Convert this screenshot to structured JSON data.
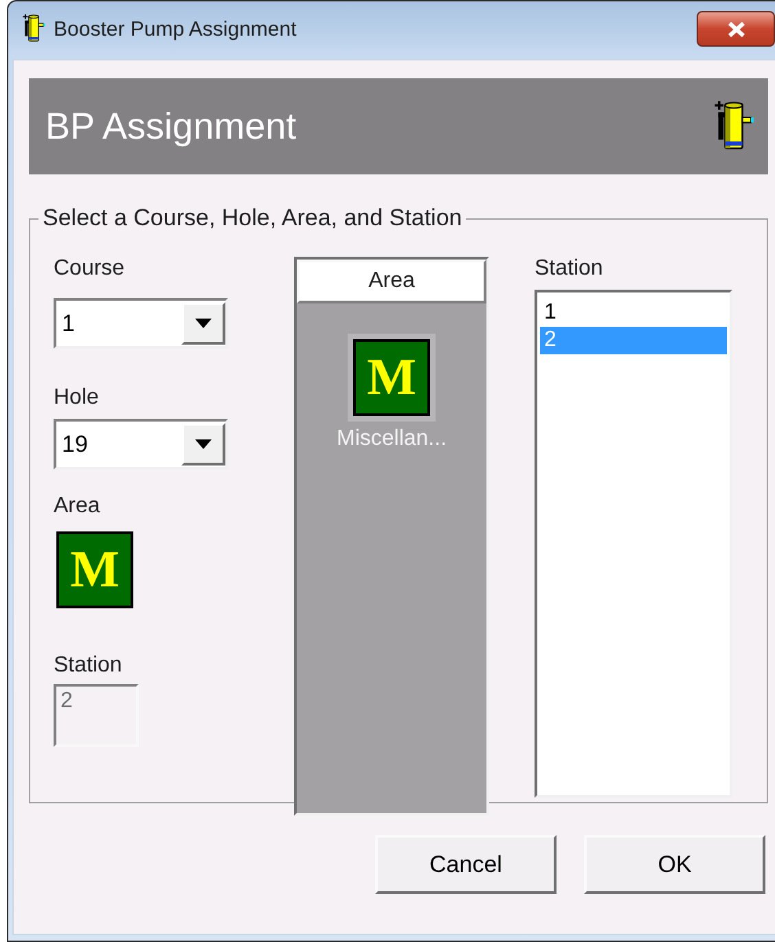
{
  "window": {
    "title": "Booster Pump Assignment"
  },
  "header": {
    "title": "BP Assignment"
  },
  "group": {
    "legend": "Select a Course, Hole, Area, and Station"
  },
  "course": {
    "label": "Course",
    "value": "1"
  },
  "hole": {
    "label": "Hole",
    "value": "19"
  },
  "area": {
    "label": "Area",
    "badge": "M"
  },
  "station": {
    "label": "Station",
    "value": "2",
    "disabled": true
  },
  "area_list": {
    "header": "Area",
    "items": [
      {
        "badge": "M",
        "label": "Miscellan..."
      }
    ]
  },
  "station_list": {
    "label": "Station",
    "items": [
      {
        "label": "1",
        "selected": false
      },
      {
        "label": "2",
        "selected": true
      }
    ]
  },
  "buttons": [
    {
      "label": "Cancel"
    },
    {
      "label": "OK"
    }
  ]
}
